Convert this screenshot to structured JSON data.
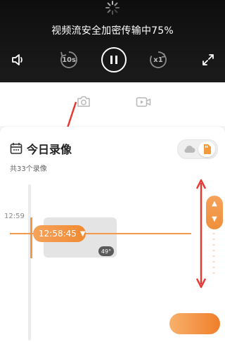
{
  "video": {
    "status_text": "视频流安全加密传输中75%",
    "rewind_label": "10s",
    "speed_label": "x1"
  },
  "recordings": {
    "title": "今日录像",
    "count_text": "共33个录像",
    "time_tick": "12:58:45"
  },
  "timeline": {
    "hour_label": "12:59",
    "current_time": "12:58:45",
    "angle": "49°"
  },
  "colors": {
    "accent": "#f29a4a",
    "annotation_red": "#e53935"
  },
  "icons": {
    "photo": "camera-icon",
    "video": "video-camera-icon",
    "cloud": "cloud-icon",
    "sd_card": "sd-card-icon"
  }
}
